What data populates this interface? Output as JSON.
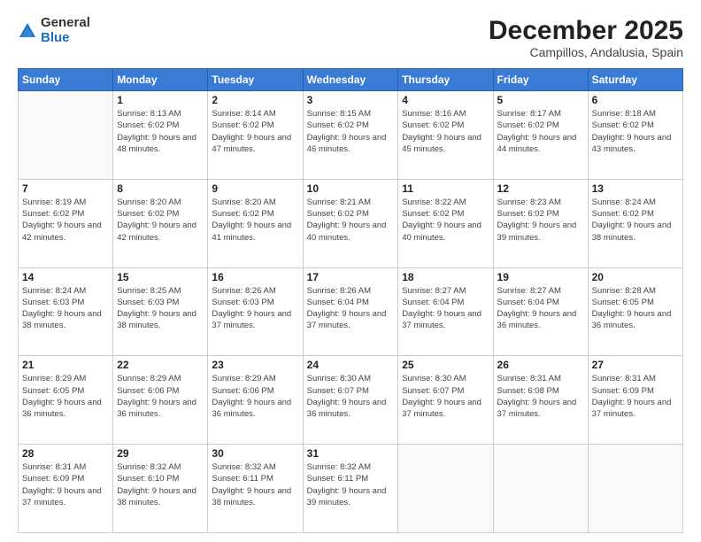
{
  "logo": {
    "general": "General",
    "blue": "Blue"
  },
  "title": "December 2025",
  "subtitle": "Campillos, Andalusia, Spain",
  "headers": [
    "Sunday",
    "Monday",
    "Tuesday",
    "Wednesday",
    "Thursday",
    "Friday",
    "Saturday"
  ],
  "weeks": [
    [
      {
        "day": "",
        "empty": true
      },
      {
        "day": "1",
        "sunrise": "8:13 AM",
        "sunset": "6:02 PM",
        "daylight": "9 hours and 48 minutes."
      },
      {
        "day": "2",
        "sunrise": "8:14 AM",
        "sunset": "6:02 PM",
        "daylight": "9 hours and 47 minutes."
      },
      {
        "day": "3",
        "sunrise": "8:15 AM",
        "sunset": "6:02 PM",
        "daylight": "9 hours and 46 minutes."
      },
      {
        "day": "4",
        "sunrise": "8:16 AM",
        "sunset": "6:02 PM",
        "daylight": "9 hours and 45 minutes."
      },
      {
        "day": "5",
        "sunrise": "8:17 AM",
        "sunset": "6:02 PM",
        "daylight": "9 hours and 44 minutes."
      },
      {
        "day": "6",
        "sunrise": "8:18 AM",
        "sunset": "6:02 PM",
        "daylight": "9 hours and 43 minutes."
      }
    ],
    [
      {
        "day": "7",
        "sunrise": "8:19 AM",
        "sunset": "6:02 PM",
        "daylight": "9 hours and 42 minutes."
      },
      {
        "day": "8",
        "sunrise": "8:20 AM",
        "sunset": "6:02 PM",
        "daylight": "9 hours and 42 minutes."
      },
      {
        "day": "9",
        "sunrise": "8:20 AM",
        "sunset": "6:02 PM",
        "daylight": "9 hours and 41 minutes."
      },
      {
        "day": "10",
        "sunrise": "8:21 AM",
        "sunset": "6:02 PM",
        "daylight": "9 hours and 40 minutes."
      },
      {
        "day": "11",
        "sunrise": "8:22 AM",
        "sunset": "6:02 PM",
        "daylight": "9 hours and 40 minutes."
      },
      {
        "day": "12",
        "sunrise": "8:23 AM",
        "sunset": "6:02 PM",
        "daylight": "9 hours and 39 minutes."
      },
      {
        "day": "13",
        "sunrise": "8:24 AM",
        "sunset": "6:02 PM",
        "daylight": "9 hours and 38 minutes."
      }
    ],
    [
      {
        "day": "14",
        "sunrise": "8:24 AM",
        "sunset": "6:03 PM",
        "daylight": "9 hours and 38 minutes."
      },
      {
        "day": "15",
        "sunrise": "8:25 AM",
        "sunset": "6:03 PM",
        "daylight": "9 hours and 38 minutes."
      },
      {
        "day": "16",
        "sunrise": "8:26 AM",
        "sunset": "6:03 PM",
        "daylight": "9 hours and 37 minutes."
      },
      {
        "day": "17",
        "sunrise": "8:26 AM",
        "sunset": "6:04 PM",
        "daylight": "9 hours and 37 minutes."
      },
      {
        "day": "18",
        "sunrise": "8:27 AM",
        "sunset": "6:04 PM",
        "daylight": "9 hours and 37 minutes."
      },
      {
        "day": "19",
        "sunrise": "8:27 AM",
        "sunset": "6:04 PM",
        "daylight": "9 hours and 36 minutes."
      },
      {
        "day": "20",
        "sunrise": "8:28 AM",
        "sunset": "6:05 PM",
        "daylight": "9 hours and 36 minutes."
      }
    ],
    [
      {
        "day": "21",
        "sunrise": "8:29 AM",
        "sunset": "6:05 PM",
        "daylight": "9 hours and 36 minutes."
      },
      {
        "day": "22",
        "sunrise": "8:29 AM",
        "sunset": "6:06 PM",
        "daylight": "9 hours and 36 minutes."
      },
      {
        "day": "23",
        "sunrise": "8:29 AM",
        "sunset": "6:06 PM",
        "daylight": "9 hours and 36 minutes."
      },
      {
        "day": "24",
        "sunrise": "8:30 AM",
        "sunset": "6:07 PM",
        "daylight": "9 hours and 36 minutes."
      },
      {
        "day": "25",
        "sunrise": "8:30 AM",
        "sunset": "6:07 PM",
        "daylight": "9 hours and 37 minutes."
      },
      {
        "day": "26",
        "sunrise": "8:31 AM",
        "sunset": "6:08 PM",
        "daylight": "9 hours and 37 minutes."
      },
      {
        "day": "27",
        "sunrise": "8:31 AM",
        "sunset": "6:09 PM",
        "daylight": "9 hours and 37 minutes."
      }
    ],
    [
      {
        "day": "28",
        "sunrise": "8:31 AM",
        "sunset": "6:09 PM",
        "daylight": "9 hours and 37 minutes."
      },
      {
        "day": "29",
        "sunrise": "8:32 AM",
        "sunset": "6:10 PM",
        "daylight": "9 hours and 38 minutes."
      },
      {
        "day": "30",
        "sunrise": "8:32 AM",
        "sunset": "6:11 PM",
        "daylight": "9 hours and 38 minutes."
      },
      {
        "day": "31",
        "sunrise": "8:32 AM",
        "sunset": "6:11 PM",
        "daylight": "9 hours and 39 minutes."
      },
      {
        "day": "",
        "empty": true
      },
      {
        "day": "",
        "empty": true
      },
      {
        "day": "",
        "empty": true
      }
    ]
  ],
  "daylight_label": "Daylight:",
  "sunrise_label": "Sunrise:",
  "sunset_label": "Sunset:"
}
